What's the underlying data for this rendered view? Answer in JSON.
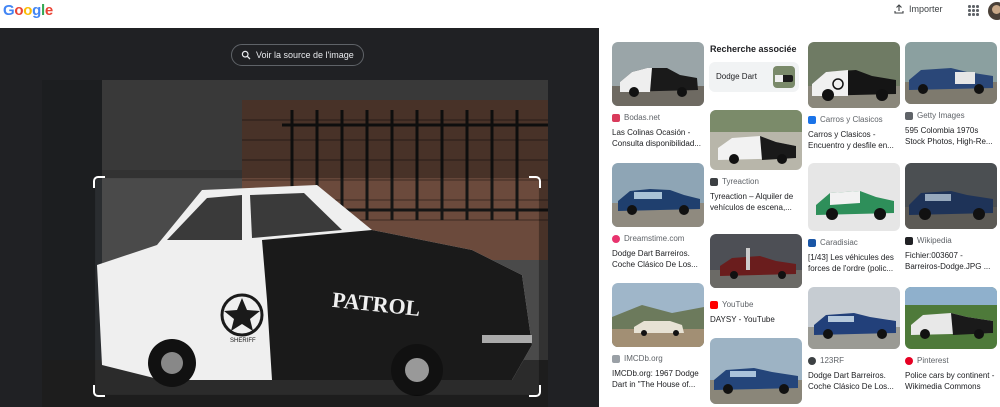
{
  "header": {
    "logo_text": "Google",
    "import_label": "Importer"
  },
  "viewer": {
    "source_button_label": "Voir la source de l'image",
    "plate_text": "PATROL",
    "badge_text": "SHERIFF"
  },
  "related": {
    "heading": "Recherche associée",
    "chip_label": "Dodge Dart"
  },
  "results": [
    {
      "source": "Bodas.net",
      "title": "Las Colinas Ocasión - Consulta disponibilidad...",
      "favicon_color": "#d93b5c",
      "favicon": "heart-icon"
    },
    {
      "source": "Carros y Clasicos",
      "title": "Carros y Clasicos - Encuentro y desfile en...",
      "favicon_color": "#1a73e8",
      "favicon": "car-icon"
    },
    {
      "source": "Getty Images",
      "title": "595 Colombia 1970s Stock Photos, High-Re...",
      "favicon_color": "#5f6368",
      "favicon": "square-icon"
    },
    {
      "source": "Tyreaction",
      "title": "Tyreaction – Alquiler de vehículos de escena,...",
      "favicon_color": "#3c4043",
      "favicon": "square-icon"
    },
    {
      "source": "Dreamstime.com",
      "title": "Dodge Dart Barreiros. Coche Clásico De Los...",
      "favicon_color": "#e8336e",
      "favicon": "circle-icon"
    },
    {
      "source": "Caradisiac",
      "title": "[1/43] Les véhicules des forces de l'ordre (polic...",
      "favicon_color": "#1a56a6",
      "favicon": "c-icon"
    },
    {
      "source": "Wikipedia",
      "title": "Fichier:003607 - Barreiros-Dodge.JPG ...",
      "favicon_color": "#202124",
      "favicon": "w-icon"
    },
    {
      "source": "YouTube",
      "title": "DAYSY - YouTube",
      "favicon_color": "#ff0000",
      "favicon": "play-icon"
    },
    {
      "source": "IMCDb.org",
      "title": "IMCDb.org: 1967 Dodge Dart in \"The House of...",
      "favicon_color": "#9aa0a6",
      "favicon": "square-icon"
    },
    {
      "source": "123RF",
      "title": "Dodge Dart Barreiros. Coche Clásico De Los...",
      "favicon_color": "#3c4043",
      "favicon": "circle-icon"
    },
    {
      "source": "Pinterest",
      "title": "Police cars by continent - Wikimedia Commons",
      "favicon_color": "#e60023",
      "favicon": "p-icon"
    }
  ],
  "colors": {
    "viewer_bg": "#202124",
    "police_white": "#efefef",
    "police_black": "#1a1a1a",
    "dodge_blue": "#1f3f6e",
    "dodge_green": "#2e8f5a"
  }
}
